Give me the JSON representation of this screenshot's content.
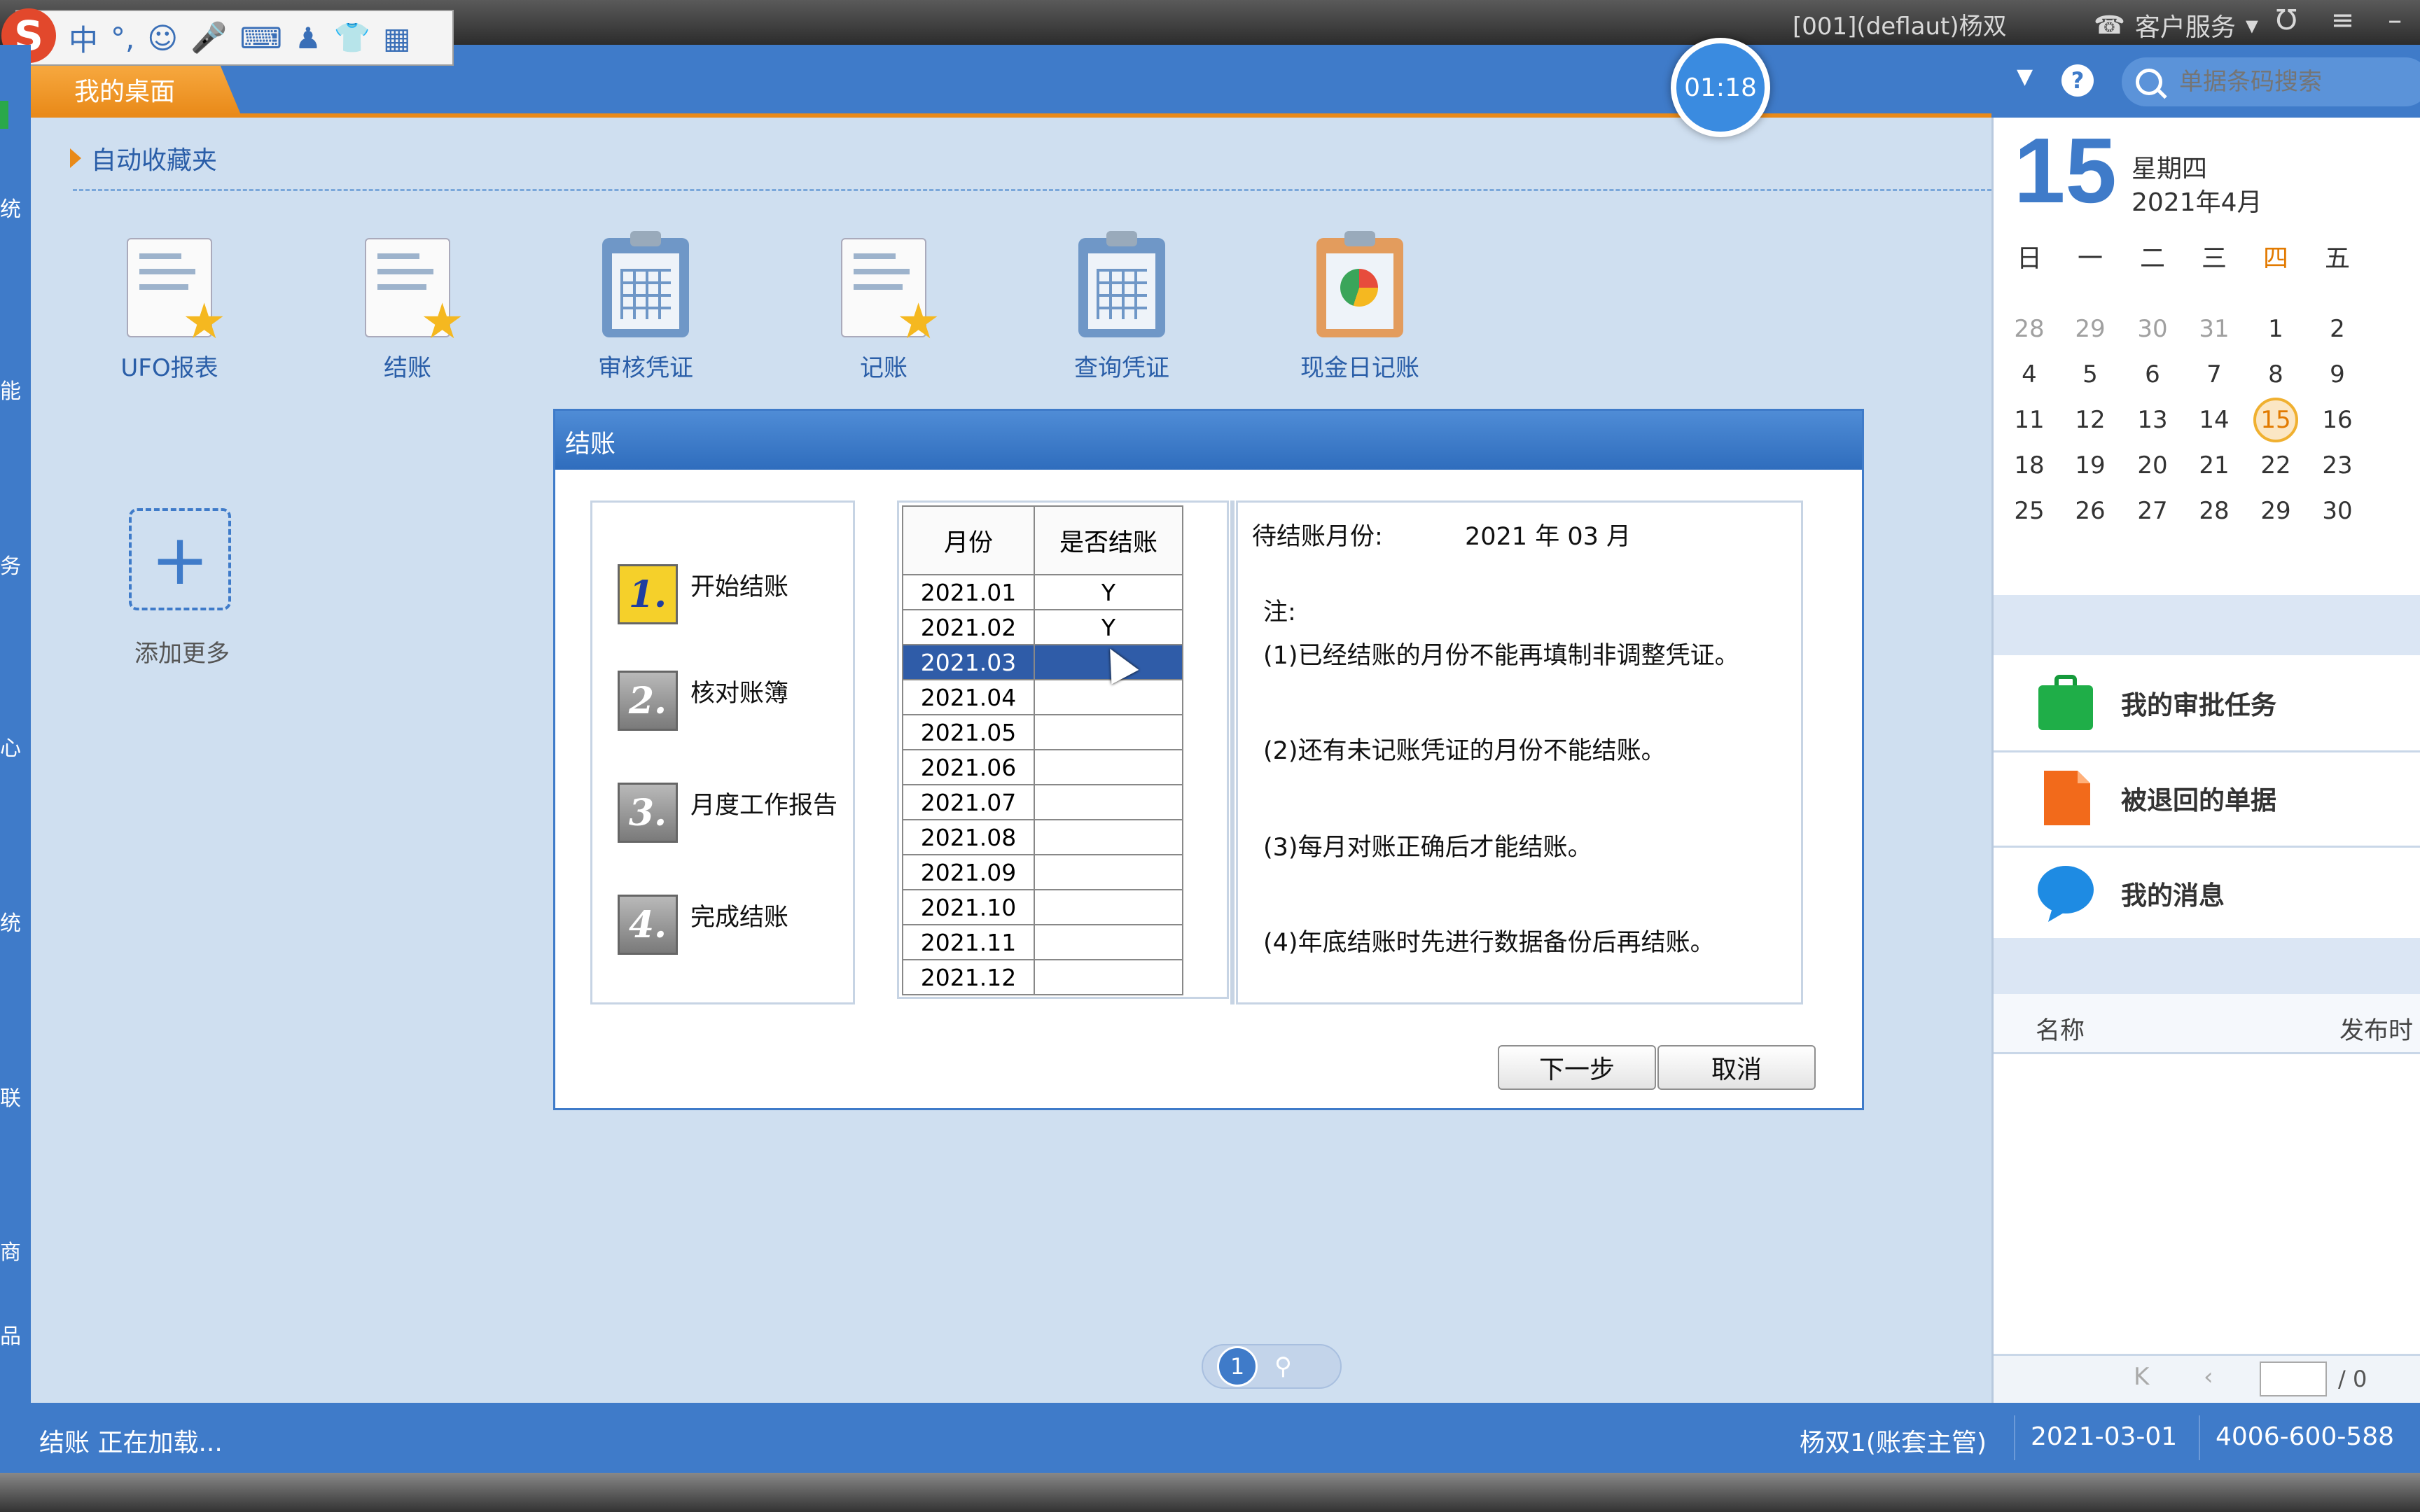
{
  "window": {
    "user_info": "[001](deflaut)杨双",
    "service_label": "客户服务"
  },
  "ime": {
    "logo": "S",
    "mode": "中",
    "punct": "°,"
  },
  "header": {
    "tab_desktop": "我的桌面",
    "timer": "01:18",
    "search_placeholder": "单据条码搜索"
  },
  "left_strip_chars": [
    "统",
    "能",
    "务",
    "心",
    "统",
    "联",
    "商",
    "品"
  ],
  "desktop": {
    "favorites_label": "自动收藏夹",
    "icons": [
      {
        "label": "UFO报表",
        "icon": "doc-star-icon"
      },
      {
        "label": "结账",
        "icon": "doc-star-icon"
      },
      {
        "label": "审核凭证",
        "icon": "clipboard-grid-icon"
      },
      {
        "label": "记账",
        "icon": "doc-star-icon"
      },
      {
        "label": "查询凭证",
        "icon": "clipboard-grid-icon"
      },
      {
        "label": "现金日记账",
        "icon": "clipboard-chart-icon"
      }
    ],
    "add_more_label": "添加更多",
    "pager_page": "1"
  },
  "dialog": {
    "title": "结账",
    "steps": [
      {
        "num": "1.",
        "label": "开始结账",
        "active": true
      },
      {
        "num": "2.",
        "label": "核对账簿",
        "active": false
      },
      {
        "num": "3.",
        "label": "月度工作报告",
        "active": false
      },
      {
        "num": "4.",
        "label": "完成结账",
        "active": false
      }
    ],
    "table": {
      "headers": [
        "月份",
        "是否结账"
      ],
      "rows": [
        [
          "2021.01",
          "Y"
        ],
        [
          "2021.02",
          "Y"
        ],
        [
          "2021.03",
          ""
        ],
        [
          "2021.04",
          ""
        ],
        [
          "2021.05",
          ""
        ],
        [
          "2021.06",
          ""
        ],
        [
          "2021.07",
          ""
        ],
        [
          "2021.08",
          ""
        ],
        [
          "2021.09",
          ""
        ],
        [
          "2021.10",
          ""
        ],
        [
          "2021.11",
          ""
        ],
        [
          "2021.12",
          ""
        ]
      ],
      "selected_row": 2
    },
    "pending_label": "待结账月份:",
    "pending_value": "2021 年 03 月",
    "note_title": "注:",
    "notes": [
      "(1)已经结账的月份不能再填制非调整凭证。",
      "(2)还有未记账凭证的月份不能结账。",
      "(3)每月对账正确后才能结账。",
      "(4)年底结账时先进行数据备份后再结账。"
    ],
    "next_button": "下一步",
    "cancel_button": "取消"
  },
  "calendar": {
    "day": "15",
    "weekday": "星期四",
    "year_month": "2021年4月",
    "weekdays": [
      "日",
      "一",
      "二",
      "三",
      "四",
      "五"
    ],
    "weeks": [
      [
        "28",
        "29",
        "30",
        "31",
        "1",
        "2"
      ],
      [
        "4",
        "5",
        "6",
        "7",
        "8",
        "9"
      ],
      [
        "11",
        "12",
        "13",
        "14",
        "15",
        "16"
      ],
      [
        "18",
        "19",
        "20",
        "21",
        "22",
        "23"
      ],
      [
        "25",
        "26",
        "27",
        "28",
        "29",
        "30"
      ]
    ],
    "today": "15"
  },
  "right_panel": {
    "items": [
      "我的审批任务",
      "被退回的单据",
      "我的消息"
    ],
    "col_name": "名称",
    "col_time": "发布时",
    "page_total": "/ 0"
  },
  "status": {
    "loading": "结账 正在加载...",
    "user": "杨双1(账套主管)",
    "date": "2021-03-01",
    "phone": "4006-600-588"
  },
  "colors": {
    "accent": "#3f7bc9",
    "orange": "#e98a19",
    "selected_row": "#2f5ca8"
  }
}
